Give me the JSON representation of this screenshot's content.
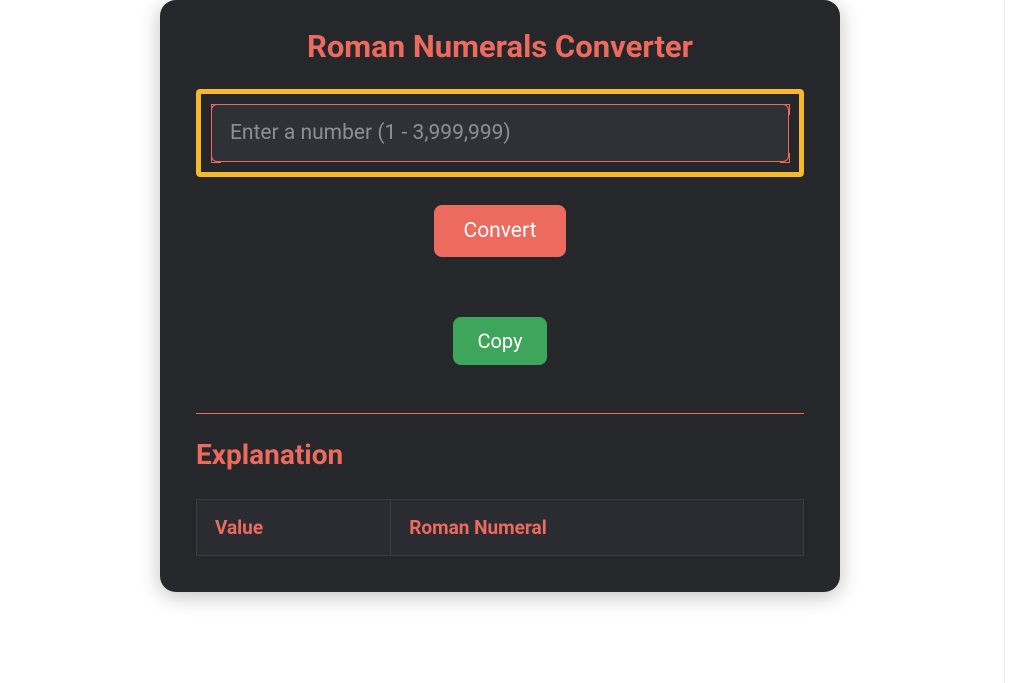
{
  "title": "Roman Numerals Converter",
  "input": {
    "placeholder": "Enter a number (1 - 3,999,999)",
    "value": ""
  },
  "buttons": {
    "convert": "Convert",
    "copy": "Copy"
  },
  "explanation": {
    "heading": "Explanation",
    "columns": {
      "value": "Value",
      "roman": "Roman Numeral"
    }
  },
  "colors": {
    "accent": "#ed6a5e",
    "highlight": "#f6b92b",
    "panel": "#25272b",
    "success": "#3da65a"
  }
}
